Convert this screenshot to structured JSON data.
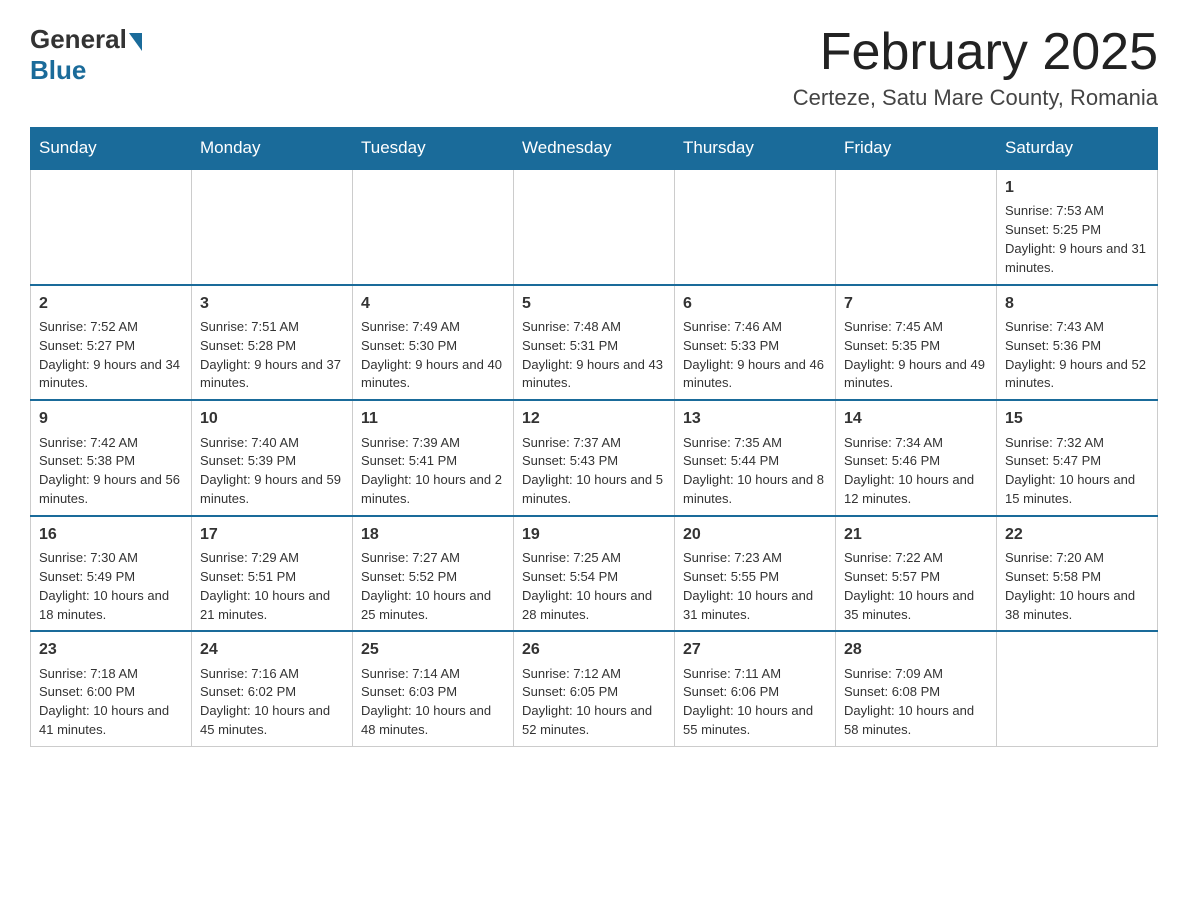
{
  "header": {
    "logo_general": "General",
    "logo_blue": "Blue",
    "month_title": "February 2025",
    "location": "Certeze, Satu Mare County, Romania"
  },
  "days_of_week": [
    "Sunday",
    "Monday",
    "Tuesday",
    "Wednesday",
    "Thursday",
    "Friday",
    "Saturday"
  ],
  "weeks": [
    [
      {
        "day": "",
        "info": ""
      },
      {
        "day": "",
        "info": ""
      },
      {
        "day": "",
        "info": ""
      },
      {
        "day": "",
        "info": ""
      },
      {
        "day": "",
        "info": ""
      },
      {
        "day": "",
        "info": ""
      },
      {
        "day": "1",
        "info": "Sunrise: 7:53 AM\nSunset: 5:25 PM\nDaylight: 9 hours and 31 minutes."
      }
    ],
    [
      {
        "day": "2",
        "info": "Sunrise: 7:52 AM\nSunset: 5:27 PM\nDaylight: 9 hours and 34 minutes."
      },
      {
        "day": "3",
        "info": "Sunrise: 7:51 AM\nSunset: 5:28 PM\nDaylight: 9 hours and 37 minutes."
      },
      {
        "day": "4",
        "info": "Sunrise: 7:49 AM\nSunset: 5:30 PM\nDaylight: 9 hours and 40 minutes."
      },
      {
        "day": "5",
        "info": "Sunrise: 7:48 AM\nSunset: 5:31 PM\nDaylight: 9 hours and 43 minutes."
      },
      {
        "day": "6",
        "info": "Sunrise: 7:46 AM\nSunset: 5:33 PM\nDaylight: 9 hours and 46 minutes."
      },
      {
        "day": "7",
        "info": "Sunrise: 7:45 AM\nSunset: 5:35 PM\nDaylight: 9 hours and 49 minutes."
      },
      {
        "day": "8",
        "info": "Sunrise: 7:43 AM\nSunset: 5:36 PM\nDaylight: 9 hours and 52 minutes."
      }
    ],
    [
      {
        "day": "9",
        "info": "Sunrise: 7:42 AM\nSunset: 5:38 PM\nDaylight: 9 hours and 56 minutes."
      },
      {
        "day": "10",
        "info": "Sunrise: 7:40 AM\nSunset: 5:39 PM\nDaylight: 9 hours and 59 minutes."
      },
      {
        "day": "11",
        "info": "Sunrise: 7:39 AM\nSunset: 5:41 PM\nDaylight: 10 hours and 2 minutes."
      },
      {
        "day": "12",
        "info": "Sunrise: 7:37 AM\nSunset: 5:43 PM\nDaylight: 10 hours and 5 minutes."
      },
      {
        "day": "13",
        "info": "Sunrise: 7:35 AM\nSunset: 5:44 PM\nDaylight: 10 hours and 8 minutes."
      },
      {
        "day": "14",
        "info": "Sunrise: 7:34 AM\nSunset: 5:46 PM\nDaylight: 10 hours and 12 minutes."
      },
      {
        "day": "15",
        "info": "Sunrise: 7:32 AM\nSunset: 5:47 PM\nDaylight: 10 hours and 15 minutes."
      }
    ],
    [
      {
        "day": "16",
        "info": "Sunrise: 7:30 AM\nSunset: 5:49 PM\nDaylight: 10 hours and 18 minutes."
      },
      {
        "day": "17",
        "info": "Sunrise: 7:29 AM\nSunset: 5:51 PM\nDaylight: 10 hours and 21 minutes."
      },
      {
        "day": "18",
        "info": "Sunrise: 7:27 AM\nSunset: 5:52 PM\nDaylight: 10 hours and 25 minutes."
      },
      {
        "day": "19",
        "info": "Sunrise: 7:25 AM\nSunset: 5:54 PM\nDaylight: 10 hours and 28 minutes."
      },
      {
        "day": "20",
        "info": "Sunrise: 7:23 AM\nSunset: 5:55 PM\nDaylight: 10 hours and 31 minutes."
      },
      {
        "day": "21",
        "info": "Sunrise: 7:22 AM\nSunset: 5:57 PM\nDaylight: 10 hours and 35 minutes."
      },
      {
        "day": "22",
        "info": "Sunrise: 7:20 AM\nSunset: 5:58 PM\nDaylight: 10 hours and 38 minutes."
      }
    ],
    [
      {
        "day": "23",
        "info": "Sunrise: 7:18 AM\nSunset: 6:00 PM\nDaylight: 10 hours and 41 minutes."
      },
      {
        "day": "24",
        "info": "Sunrise: 7:16 AM\nSunset: 6:02 PM\nDaylight: 10 hours and 45 minutes."
      },
      {
        "day": "25",
        "info": "Sunrise: 7:14 AM\nSunset: 6:03 PM\nDaylight: 10 hours and 48 minutes."
      },
      {
        "day": "26",
        "info": "Sunrise: 7:12 AM\nSunset: 6:05 PM\nDaylight: 10 hours and 52 minutes."
      },
      {
        "day": "27",
        "info": "Sunrise: 7:11 AM\nSunset: 6:06 PM\nDaylight: 10 hours and 55 minutes."
      },
      {
        "day": "28",
        "info": "Sunrise: 7:09 AM\nSunset: 6:08 PM\nDaylight: 10 hours and 58 minutes."
      },
      {
        "day": "",
        "info": ""
      }
    ]
  ]
}
